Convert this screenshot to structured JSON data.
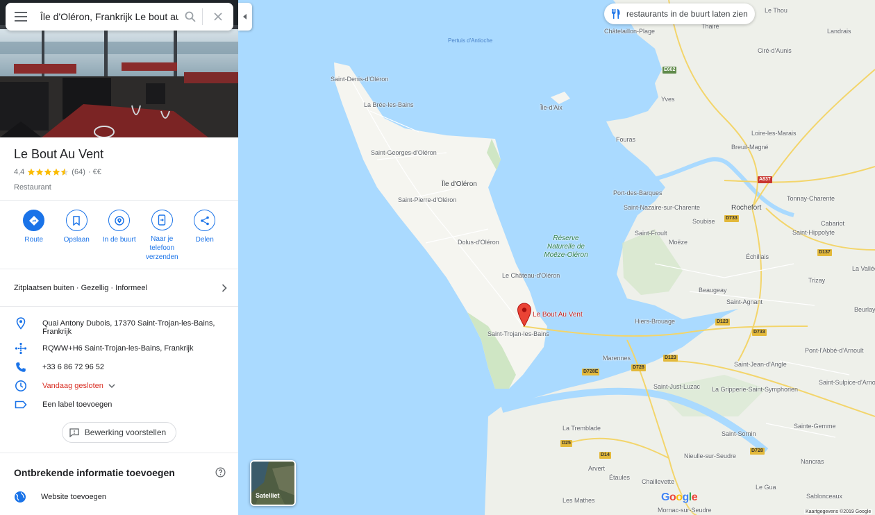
{
  "search": {
    "query": "Île d'Oléron, Frankrijk   Le bout au"
  },
  "place": {
    "title": "Le Bout Au Vent",
    "rating": "4,4",
    "rating_value": 4.4,
    "rating_max": 5,
    "review_count": "(64)",
    "price": "· €€",
    "category": "Restaurant"
  },
  "actions": [
    {
      "label": "Route",
      "icon": "directions-icon"
    },
    {
      "label": "Opslaan",
      "icon": "bookmark-icon"
    },
    {
      "label": "In de buurt",
      "icon": "nearby-icon"
    },
    {
      "label": "Naar je telefoon verzenden",
      "icon": "send-to-phone-icon"
    },
    {
      "label": "Delen",
      "icon": "share-icon"
    }
  ],
  "attributes": "Zitplaatsen buiten · Gezellig · Informeel",
  "info": {
    "address": "Quai Antony Dubois, 17370 Saint-Trojan-les-Bains, Frankrijk",
    "plus_code": "RQWW+H6 Saint-Trojan-les-Bains, Frankrijk",
    "phone": "+33 6 86 72 96 52",
    "hours": "Vandaag gesloten",
    "label": "Een label toevoegen"
  },
  "suggest_edit": "Bewerking voorstellen",
  "missing": {
    "title": "Ontbrekende informatie toevoegen",
    "website": "Website toevoegen"
  },
  "map": {
    "nearby_chip": "restaurants in de buurt laten zien",
    "pin_label": "Le Bout Au Vent",
    "satellite": "Satelliet",
    "google": "Google",
    "copyright": "Kaartgegevens ©2019 Google",
    "labels": {
      "le_thou": "Le Thou",
      "thaire": "Thairé",
      "landrais": "Landrais",
      "chatelaillon": "Châtelaillon-Plage",
      "pertuis": "Pertuis d'Antioche",
      "cire": "Ciré-d'Aunis",
      "saint_denis": "Saint-Denis-d'Oléron",
      "la_bree": "La Brée-les-Bains",
      "ile_daix": "Île-d'Aix",
      "yves": "Yves",
      "loire_marais": "Loire-les-Marais",
      "breuil": "Breuil-Magné",
      "fouras": "Fouras",
      "saint_georges": "Saint-Georges-d'Oléron",
      "ile_oleron": "Île d'Oléron",
      "port_des_barques": "Port-des-Barques",
      "saint_nazaire": "Saint-Nazaire-sur-Charente",
      "rochefort": "Rochefort",
      "tonnay": "Tonnay-Charente",
      "saint_pierre": "Saint-Pierre-d'Oléron",
      "soubise": "Soubise",
      "cabariot": "Cabariot",
      "saint_froult": "Saint-Froult",
      "reserve": "Réserve Naturelle de Moëze-Oléron",
      "moeze": "Moëze",
      "saint_hippolyte": "Saint-Hippolyte",
      "dolus": "Dolus-d'Oléron",
      "echillais": "Échillais",
      "la_vallee": "La Vallée",
      "le_chateau": "Le Château-d'Oléron",
      "trizay": "Trizay",
      "beaugeay": "Beaugeay",
      "saint_agnant": "Saint-Agnant",
      "beurlay": "Beurlay",
      "hiers": "Hiers-Brouage",
      "saint_trojan": "Saint-Trojan-les-Bains",
      "pont_abbe": "Pont-l'Abbé-d'Arnoult",
      "marennes": "Marennes",
      "saint_jean": "Saint-Jean-d'Angle",
      "saint_just": "Saint-Just-Luzac",
      "la_gripperie": "La Gripperie-Saint-Symphorien",
      "saint_sulpice": "Saint-Sulpice-d'Arnoult",
      "la_tremblade": "La Tremblade",
      "sainte_gemme": "Sainte-Gemme",
      "saint_sornin": "Saint-Sornin",
      "nieulle": "Nieulle-sur-Seudre",
      "nancras": "Nancras",
      "arvert": "Arvert",
      "etaules": "Étaules",
      "chaillevette": "Chaillevette",
      "le_gua": "Le Gua",
      "les_mathes": "Les Mathes",
      "mornac": "Mornac-sur-Seudre",
      "sablonceaux": "Sablonceaux"
    },
    "roads": {
      "e602": "E602",
      "a837": "A837",
      "d733a": "D733",
      "d137": "D137",
      "d123a": "D123",
      "d733b": "D733",
      "d728": "D728",
      "d123b": "D123",
      "d728e": "D728E",
      "d25": "D25",
      "d14": "D14",
      "d728b": "D728"
    }
  },
  "colors": {
    "accent": "#1a73e8",
    "water": "#aadaff",
    "land": "#f1f3f4",
    "pin": "#ea4335",
    "closed": "#d93025"
  }
}
